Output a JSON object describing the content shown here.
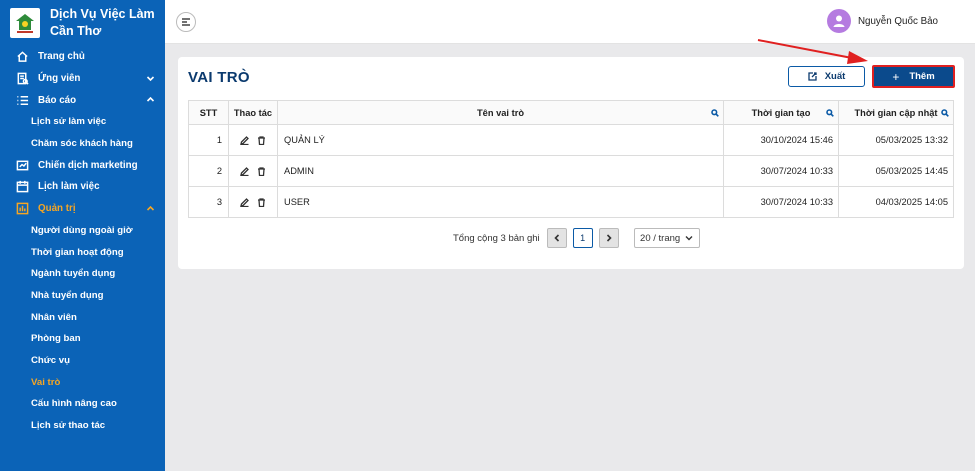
{
  "brand": {
    "name_line1": "Dịch Vụ Việc Làm",
    "name_line2": "Cần Thơ"
  },
  "sidebar": {
    "items": [
      {
        "label": "Trang chủ",
        "icon": "home-icon"
      },
      {
        "label": "Ứng viên",
        "icon": "candidate-icon",
        "chevron": "chevron-down-icon"
      },
      {
        "label": "Báo cáo",
        "icon": "list-icon",
        "chevron": "chevron-up-icon"
      },
      {
        "label": "Lịch sử làm việc",
        "sub": true
      },
      {
        "label": "Chăm sóc khách hàng",
        "sub": true
      },
      {
        "label": "Chiến dịch marketing",
        "icon": "marketing-icon"
      },
      {
        "label": "Lịch làm việc",
        "icon": "calendar-icon"
      },
      {
        "label": "Quản trị",
        "icon": "admin-icon",
        "chevron": "chevron-up-icon",
        "active": true
      },
      {
        "label": "Người dùng ngoài giờ",
        "sub": true
      },
      {
        "label": "Thời gian hoạt động",
        "sub": true
      },
      {
        "label": "Ngành tuyển dụng",
        "sub": true
      },
      {
        "label": "Nhà tuyển dụng",
        "sub": true
      },
      {
        "label": "Nhân viên",
        "sub": true
      },
      {
        "label": "Phòng ban",
        "sub": true
      },
      {
        "label": "Chức vụ",
        "sub": true
      },
      {
        "label": "Vai trò",
        "sub": true,
        "current": true
      },
      {
        "label": "Cấu hình nâng cao",
        "sub": true
      },
      {
        "label": "Lịch sử thao tác",
        "sub": true
      }
    ]
  },
  "header": {
    "user_name": "Nguyễn Quốc Bảo"
  },
  "main": {
    "title": "VAI TRÒ",
    "export_label": "Xuất",
    "add_label": "Thêm",
    "columns": {
      "stt": "STT",
      "actions": "Thao tác",
      "name": "Tên vai trò",
      "created": "Thời gian tạo",
      "updated": "Thời gian cập nhật"
    },
    "rows": [
      {
        "stt": "1",
        "name": "QUẢN LÝ",
        "created": "30/10/2024 15:46",
        "updated": "05/03/2025 13:32"
      },
      {
        "stt": "2",
        "name": "ADMIN",
        "created": "30/07/2024 10:33",
        "updated": "05/03/2025 14:45"
      },
      {
        "stt": "3",
        "name": "USER",
        "created": "30/07/2024 10:33",
        "updated": "04/03/2025 14:05"
      }
    ],
    "pagination": {
      "total_text": "Tổng cộng 3 bản ghi",
      "current_page": "1",
      "page_size": "20 / trang"
    }
  },
  "colors": {
    "sidebar": "#0b63b7",
    "accent": "#f6a623",
    "primary_button": "#0b4a8c",
    "highlight": "#e02020"
  }
}
